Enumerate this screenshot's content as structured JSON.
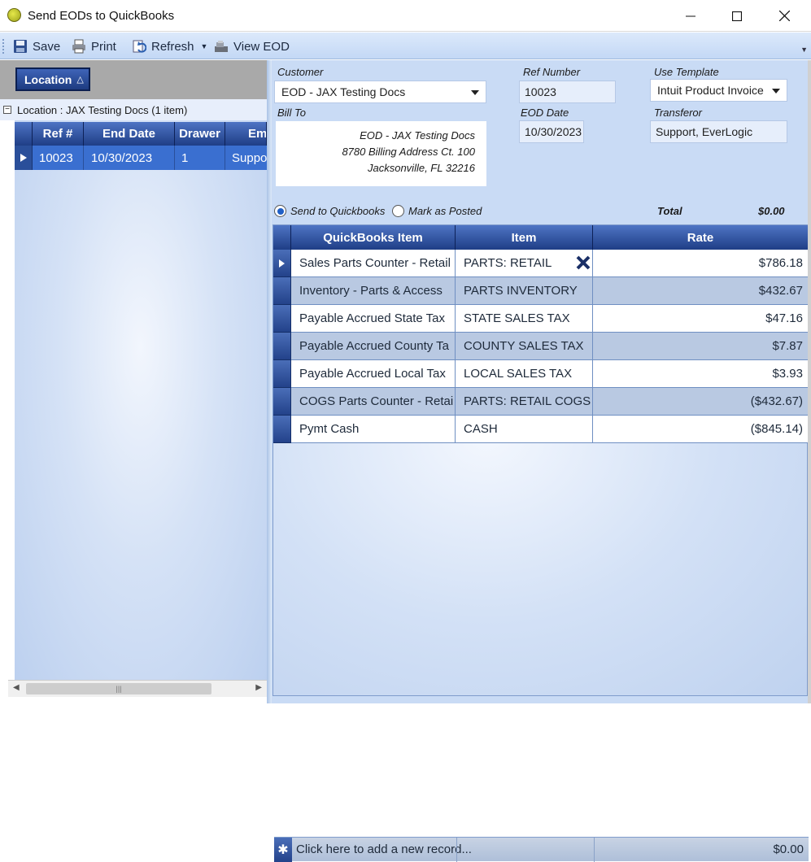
{
  "window": {
    "title": "Send EODs to QuickBooks"
  },
  "toolbar": {
    "save": "Save",
    "print": "Print",
    "refresh": "Refresh",
    "view_eod": "View EOD"
  },
  "left": {
    "group_header": "Location",
    "group_row": "Location : JAX Testing Docs (1 item)",
    "columns": [
      "Ref #",
      "End Date",
      "Drawer",
      "Emplo"
    ],
    "row": {
      "ref": "10023",
      "end_date": "10/30/2023",
      "drawer": "1",
      "employee": "Support,"
    }
  },
  "form": {
    "customer_label": "Customer",
    "customer_value": "EOD - JAX Testing Docs",
    "ref_label": "Ref Number",
    "ref_value": "10023",
    "template_label": "Use Template",
    "template_value": "Intuit Product Invoice",
    "billto_label": "Bill To",
    "billto_lines": [
      "EOD - JAX Testing Docs",
      "8780 Billing Address Ct. 100",
      "Jacksonville, FL 32216"
    ],
    "eod_date_label": "EOD Date",
    "eod_date_value": "10/30/2023",
    "transferor_label": "Transferor",
    "transferor_value": "Support, EverLogic",
    "radio_send": "Send to Quickbooks",
    "radio_posted": "Mark as Posted",
    "total_label": "Total",
    "total_value": "$0.00"
  },
  "items": {
    "columns": [
      "QuickBooks Item",
      "Item",
      "Rate"
    ],
    "rows": [
      {
        "qb": "Sales Parts Counter - Retail",
        "item": "PARTS: RETAIL",
        "rate": "$786.18"
      },
      {
        "qb": "Inventory - Parts & Access",
        "item": "PARTS INVENTORY",
        "rate": "$432.67"
      },
      {
        "qb": "Payable Accrued State Tax",
        "item": "STATE SALES TAX",
        "rate": "$47.16"
      },
      {
        "qb": "Payable Accrued County Ta",
        "item": "COUNTY SALES TAX",
        "rate": "$7.87"
      },
      {
        "qb": "Payable Accrued Local Tax",
        "item": "LOCAL SALES TAX",
        "rate": "$3.93"
      },
      {
        "qb": "COGS Parts Counter - Retai",
        "item": "PARTS: RETAIL COGS",
        "rate": "($432.67)"
      },
      {
        "qb": "Pymt Cash",
        "item": "CASH",
        "rate": "($845.14)"
      }
    ],
    "new_record": "Click here to add a new record...",
    "footer_total": "$0.00"
  }
}
